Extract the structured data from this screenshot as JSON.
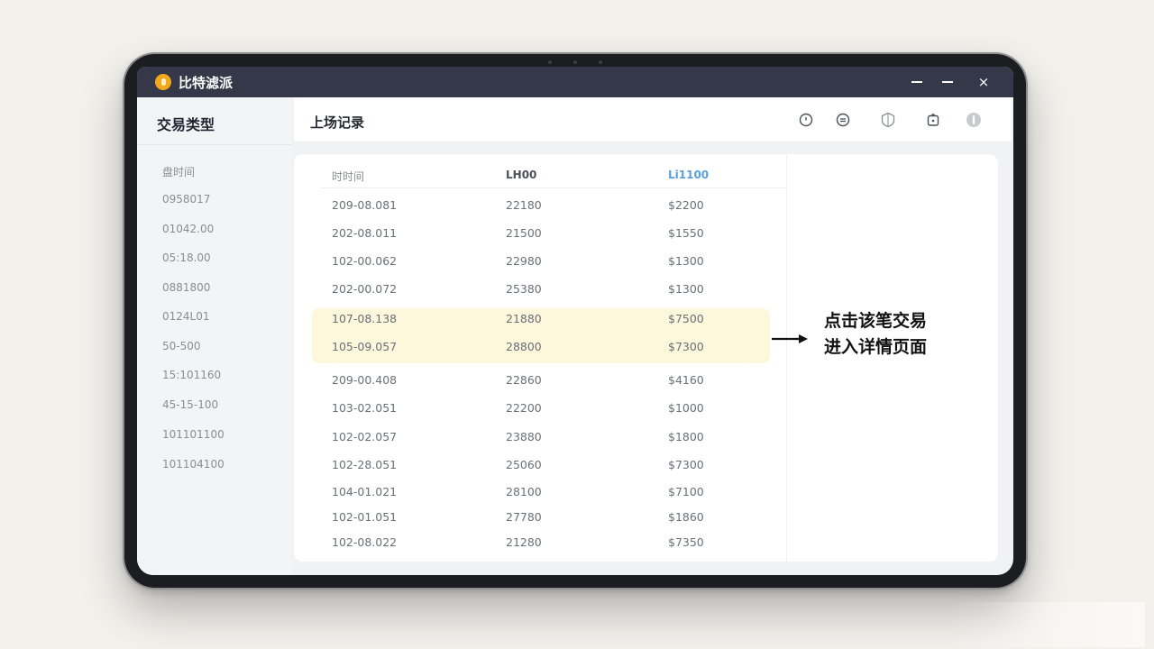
{
  "window": {
    "title": "比特滤派",
    "controls": {
      "minimize1": "–",
      "minimize2": "–",
      "close": "×"
    }
  },
  "sidebar": {
    "title": "交易类型",
    "items": [
      "盘时间",
      "0958017",
      "01042.00",
      "05:18.00",
      "0881800",
      "0124L01",
      "50-500",
      "15:101160",
      "45-15-100",
      "101101100",
      "101104100"
    ]
  },
  "header": {
    "title": "上场记录",
    "icons": [
      "clock-icon",
      "chat-icon",
      "shield-icon",
      "box-icon",
      "info-icon"
    ]
  },
  "table": {
    "columns": [
      "时时间",
      "LH00",
      "Li1100"
    ],
    "accent_column_color": "#5aa0d8",
    "rows": [
      {
        "date": "209-08.081",
        "amount": "22180",
        "price": "$2200"
      },
      {
        "date": "202-08.011",
        "amount": "21500",
        "price": "$1550"
      },
      {
        "date": "102-00.062",
        "amount": "22980",
        "price": "$1300"
      },
      {
        "date": "202-00.072",
        "amount": "25380",
        "price": "$1300"
      },
      {
        "date": "107-08.138",
        "amount": "21880",
        "price": "$7500"
      },
      {
        "date": "105-09.057",
        "amount": "28800",
        "price": "$7300"
      },
      {
        "date": "209-00.408",
        "amount": "22860",
        "price": "$4160"
      },
      {
        "date": "103-02.051",
        "amount": "22200",
        "price": "$1000"
      },
      {
        "date": "102-02.057",
        "amount": "23880",
        "price": "$1800"
      },
      {
        "date": "102-28.051",
        "amount": "25060",
        "price": "$7300"
      },
      {
        "date": "104-01.021",
        "amount": "28100",
        "price": "$7100"
      },
      {
        "date": "102-01.051",
        "amount": "27780",
        "price": "$1860"
      },
      {
        "date": "102-08.022",
        "amount": "21280",
        "price": "$7350"
      }
    ],
    "highlight_color": "#fdf7dc"
  },
  "annotation": {
    "line1": "点击该笔交易",
    "line2": "进入详情页面"
  }
}
